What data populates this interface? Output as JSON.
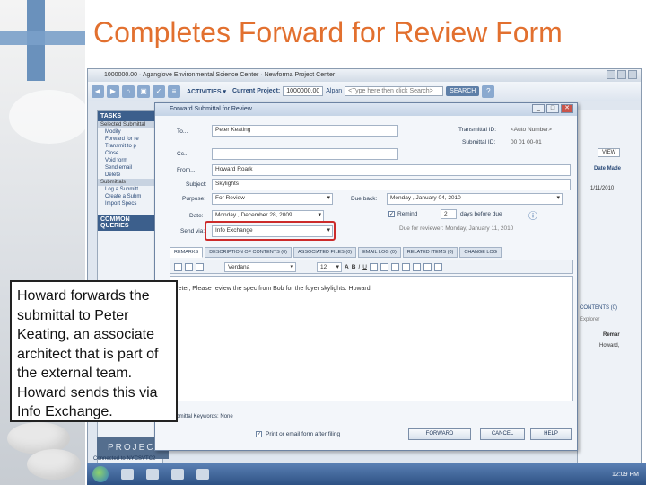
{
  "slide": {
    "title": "Completes Forward for Review Form"
  },
  "app": {
    "window_title": "1000000.00 · Aganglove Environmental Science Center · Newforma Project Center",
    "toolbar": {
      "activities_label": "ACTIVITIES ▾",
      "current_project_label": "Current Project:",
      "project_value": "1000000.00",
      "project_location": "Alpan",
      "search_placeholder": "<Type here then click Search>",
      "search_button": "SEARCH"
    },
    "sidebar": {
      "header": "TASKS",
      "sub1": "Selected Submittal",
      "items": [
        "Modify",
        "Forward for re",
        "Transmit to p",
        "Close",
        "Void form",
        "Send email",
        "Delete"
      ],
      "sub2": "Submittals",
      "items2": [
        "Log a Submitt",
        "Create a Subm",
        "Import Specs"
      ],
      "common": "COMMON QUERIES"
    },
    "right_panel": {
      "btn_view": "VIEW",
      "date_label": "Date Made",
      "date_value": "1/11/2010",
      "contents_label": "CONTENTS (0)",
      "explorer": "Explorer",
      "remarks_label": "Remar",
      "remarks_value": "Howard,"
    },
    "project_bar": "PROJEC",
    "status_text": "Connected to NYCSVTC2"
  },
  "dialog": {
    "title": "Forward Submittal for Review",
    "to_label": "To...",
    "to_value": "Peter Keating",
    "cc_label": "Cc...",
    "from_label": "From...",
    "from_value": "Howard Roark",
    "subject_label": "Subject:",
    "subject_value": "Skylights",
    "purpose_label": "Purpose:",
    "purpose_value": "For Review",
    "due_label": "Date:",
    "due_value": "Monday , December 28, 2009",
    "sendvia_label": "Send via:",
    "sendvia_value": "Info Exchange",
    "transmittal_label": "Transmittal ID:",
    "transmittal_value": "<Auto Number>",
    "submittal_label": "Submittal ID:",
    "submittal_value": "00 01 00-01",
    "due_back_label": "Due back:",
    "due_back_value": "Monday , January 04, 2010",
    "remind_label": "Remind",
    "remind_days": "2",
    "remind_suffix": "days before due",
    "reminder_note": "Due for reviewer: Monday, January 11, 2010",
    "tabs": [
      "REMARKS",
      "DESCRIPTION OF CONTENTS (0)",
      "ASSOCIATED FILES (0)",
      "EMAIL LOG (0)",
      "RELATED ITEMS (0)",
      "CHANGE LOG"
    ],
    "font_name": "Verdana",
    "font_size": "12",
    "remarks_text": "Peter, Please review the spec from Bob for the foyer skylights. Howard",
    "keywords_label": "Submittal Keywords: None",
    "print_label": "Print or email form after filing",
    "btn_forward": "FORWARD",
    "btn_cancel": "CANCEL",
    "btn_help": "HELP"
  },
  "callout": {
    "text": "Howard forwards the submittal to Peter Keating, an associate architect that is part of the external team. Howard sends this via Info Exchange."
  },
  "taskbar": {
    "clock": "12:09 PM"
  }
}
